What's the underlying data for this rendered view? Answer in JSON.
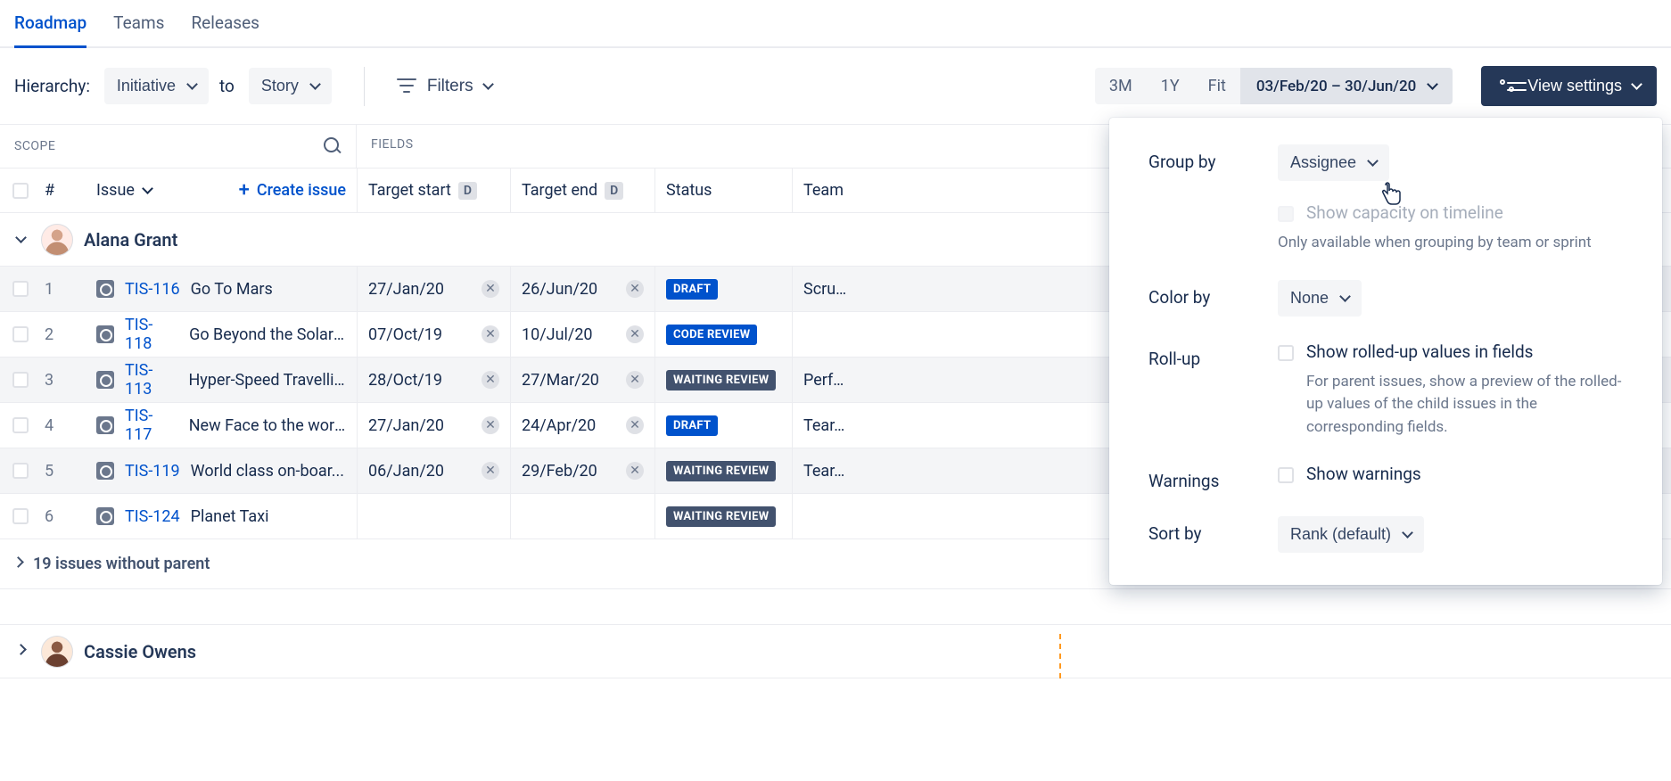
{
  "tabs": {
    "roadmap": "Roadmap",
    "teams": "Teams",
    "releases": "Releases"
  },
  "toolbar": {
    "hierarchy_label": "Hierarchy:",
    "from": "Initiative",
    "to_label": "to",
    "to": "Story",
    "filters": "Filters",
    "range_3m": "3M",
    "range_1y": "1Y",
    "range_fit": "Fit",
    "date_range": "03/Feb/20 – 30/Jun/20",
    "view_settings": "View settings"
  },
  "headers": {
    "scope": "SCOPE",
    "fields": "FIELDS",
    "num": "#",
    "issue": "Issue",
    "create_issue": "Create issue",
    "target_start": "Target start",
    "target_end": "Target end",
    "d_badge": "D",
    "status": "Status",
    "team": "Team"
  },
  "groups": {
    "g1": {
      "name": "Alana Grant"
    },
    "g2": {
      "name": "Cassie Owens"
    }
  },
  "rows": [
    {
      "num": "1",
      "key": "TIS-116",
      "summary": "Go To Mars",
      "tstart": "27/Jan/20",
      "tend": "26/Jun/20",
      "status": "DRAFT",
      "status_kind": "draft",
      "team": "Scru…"
    },
    {
      "num": "2",
      "key": "TIS-118",
      "summary": "Go Beyond the Solar ...",
      "tstart": "07/Oct/19",
      "tend": "10/Jul/20",
      "status": "CODE REVIEW",
      "status_kind": "code",
      "team": ""
    },
    {
      "num": "3",
      "key": "TIS-113",
      "summary": "Hyper-Speed Travelling",
      "tstart": "28/Oct/19",
      "tend": "27/Mar/20",
      "status": "WAITING REVIEW",
      "status_kind": "wait",
      "team": "Perf…"
    },
    {
      "num": "4",
      "key": "TIS-117",
      "summary": "New Face to the worl...",
      "tstart": "27/Jan/20",
      "tend": "24/Apr/20",
      "status": "DRAFT",
      "status_kind": "draft",
      "team": "Tear…"
    },
    {
      "num": "5",
      "key": "TIS-119",
      "summary": "World class on-boar...",
      "tstart": "06/Jan/20",
      "tend": "29/Feb/20",
      "status": "WAITING REVIEW",
      "status_kind": "wait",
      "team": "Tear…"
    },
    {
      "num": "6",
      "key": "TIS-124",
      "summary": "Planet Taxi",
      "tstart": "",
      "tend": "",
      "status": "WAITING REVIEW",
      "status_kind": "wait",
      "team": ""
    }
  ],
  "without_parent": "19 issues without parent",
  "panel": {
    "group_by_label": "Group by",
    "group_by_value": "Assignee",
    "capacity_label": "Show capacity on timeline",
    "capacity_helper": "Only available when grouping by team or sprint",
    "color_by_label": "Color by",
    "color_by_value": "None",
    "rollup_label": "Roll-up",
    "rollup_chk": "Show rolled-up values in fields",
    "rollup_helper": "For parent issues, show a preview of the rolled-up values of the child issues in the corresponding fields.",
    "warnings_label": "Warnings",
    "warnings_chk": "Show warnings",
    "sortby_label": "Sort by",
    "sortby_value": "Rank (default)"
  }
}
